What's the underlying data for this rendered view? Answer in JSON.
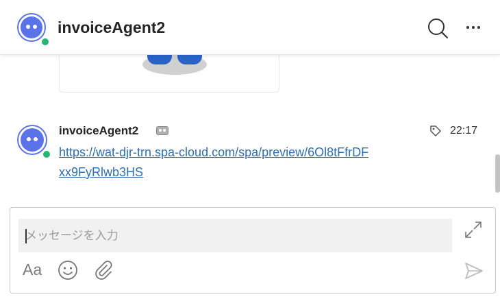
{
  "header": {
    "title": "invoiceAgent2"
  },
  "message": {
    "sender": "invoiceAgent2",
    "time": "22:17",
    "link": "https://wat-djr-trn.spa-cloud.com/spa/preview/6Ol8tFfrDFxx9FyRlwb3HS"
  },
  "compose": {
    "placeholder": "メッセージを入力",
    "format_label": "Aa"
  },
  "colors": {
    "avatar": "#5b73e8",
    "presence": "#22b573",
    "link": "#2f6fb0"
  }
}
